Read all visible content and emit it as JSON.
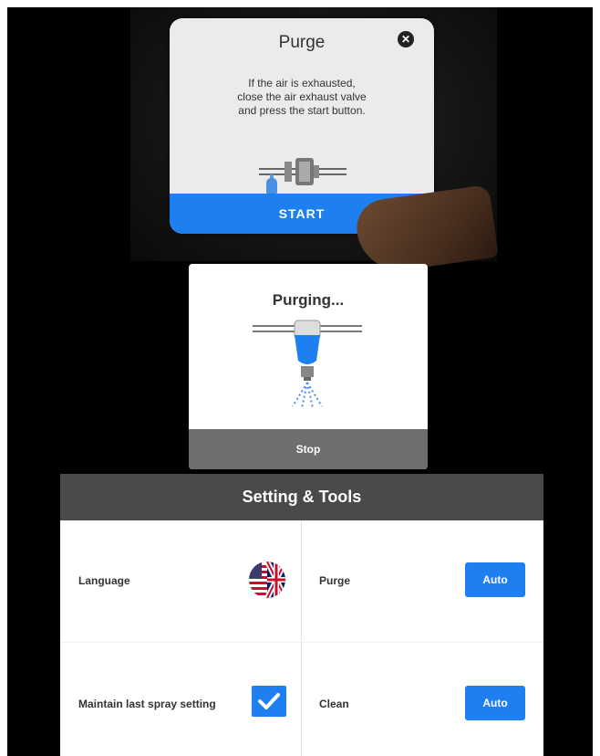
{
  "dialog_purge": {
    "title": "Purge",
    "message_line1": "If the air is exhausted,",
    "message_line2": "close the air exhaust valve",
    "message_line3": "and press the start button.",
    "start_label": "START",
    "close_glyph": "✕"
  },
  "dialog_purging": {
    "title": "Purging...",
    "stop_label": "Stop"
  },
  "settings": {
    "title": "Setting & Tools",
    "language_label": "Language",
    "purge_label": "Purge",
    "purge_value": "Auto",
    "maintain_label": "Maintain last spray setting",
    "maintain_checked": true,
    "clean_label": "Clean",
    "clean_value": "Auto"
  },
  "colors": {
    "accent": "#1d7ff0",
    "header": "#4a4a4a",
    "stop_bar": "#6e6e6e"
  },
  "icons": {
    "close": "close-icon",
    "language_flag": "us-uk-flag-icon",
    "checkbox": "checkmark-icon",
    "nozzle": "spray-nozzle-icon"
  }
}
